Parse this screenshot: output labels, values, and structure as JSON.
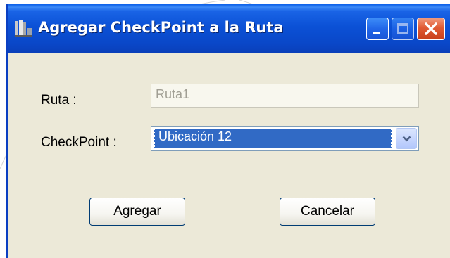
{
  "window": {
    "title": "Agregar CheckPoint a la Ruta",
    "icon": "route-app-icon",
    "controls": [
      "minimize-icon",
      "maximize-icon",
      "close-icon"
    ]
  },
  "form": {
    "ruta_label": "Ruta :",
    "ruta_value": "Ruta1",
    "checkpoint_label": "CheckPoint :",
    "checkpoint_selected": "Ubicación 12"
  },
  "buttons": {
    "agregar": "Agregar",
    "cancelar": "Cancelar"
  },
  "colors": {
    "titlebar": "#0a47c8",
    "window_face": "#ece9d8",
    "selection": "#316ac5",
    "close_button": "#e05a33"
  }
}
